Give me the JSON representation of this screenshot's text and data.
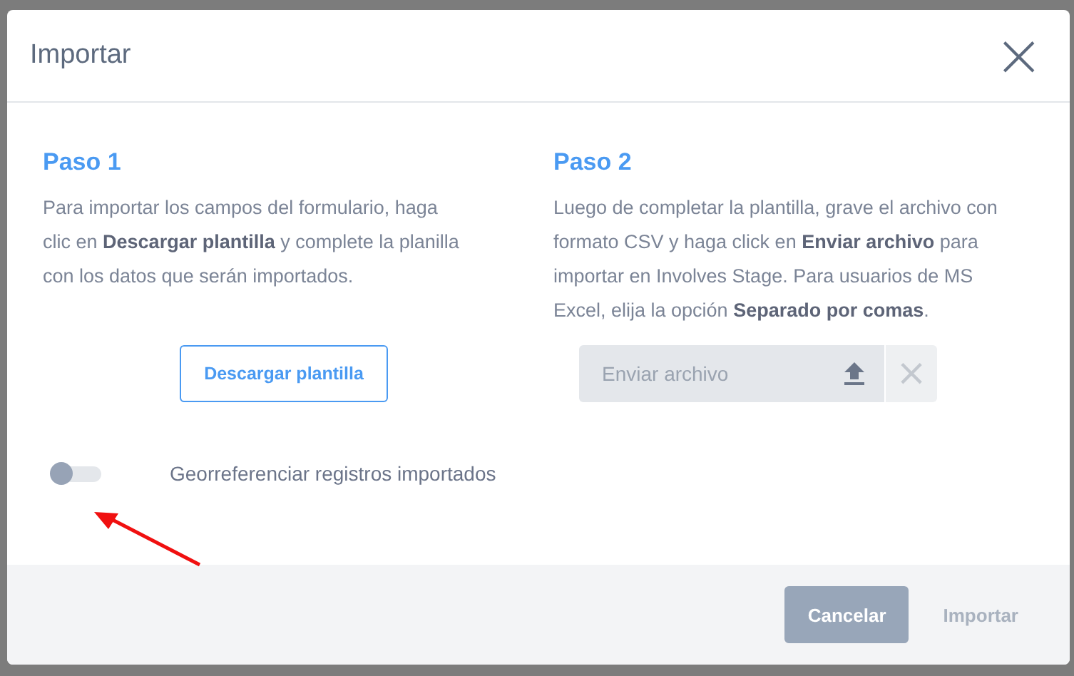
{
  "dialog": {
    "title": "Importar",
    "close": "×"
  },
  "steps": [
    {
      "title": "Paso 1",
      "text": "Para importar los campos del formulario, haga clic en **Descargar plantilla** y complete la planilla con los datos que serán importados.",
      "kind": "download",
      "button": "Descargar plantilla"
    },
    {
      "title": "Paso 2",
      "text": "Luego de completar la plantilla, grave el archivo con formato CSV y haga click en **Enviar archivo** para importar en Involves Stage. Para usuarios de MS Excel, elija la opción **Separado por comas**.",
      "kind": "upload",
      "placeholder": "Enviar archivo",
      "clear": "×"
    }
  ],
  "toggle": {
    "label": "Georreferenciar registros importados",
    "on": false
  },
  "buttons": [
    {
      "label": "Cancelar",
      "disabled": false,
      "kind": "secondary"
    },
    {
      "label": "Importar",
      "disabled": true,
      "kind": "primary"
    }
  ]
}
